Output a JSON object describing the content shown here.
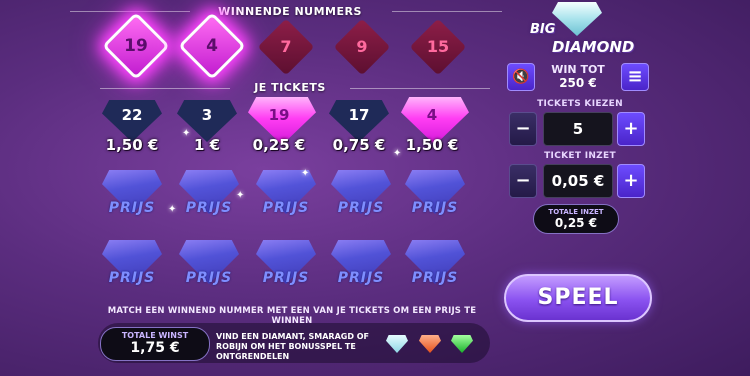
{
  "winning_section": {
    "title": "WINNENDE NUMMERS",
    "numbers": [
      {
        "value": "19",
        "matched": true
      },
      {
        "value": "4",
        "matched": true
      },
      {
        "value": "7",
        "matched": false
      },
      {
        "value": "9",
        "matched": false
      },
      {
        "value": "15",
        "matched": false
      }
    ]
  },
  "tickets_section": {
    "title": "JE TICKETS",
    "row1": [
      {
        "number": "22",
        "price": "1,50 €",
        "matched": false
      },
      {
        "number": "3",
        "price": "1 €",
        "matched": false
      },
      {
        "number": "19",
        "price": "0,25 €",
        "matched": true
      },
      {
        "number": "17",
        "price": "0,75 €",
        "matched": false
      },
      {
        "number": "4",
        "price": "1,50 €",
        "matched": true
      }
    ],
    "cover_label": "PRIJS"
  },
  "instruction": "MATCH EEN WINNEND NUMMER MET EEN VAN JE TICKETS OM EEN PRIJS TE WINNEN",
  "total_win": {
    "label": "TOTALE WINST",
    "value": "1,75 €"
  },
  "bonus_text": "VIND EEN DIAMANT, SMARAGD OF ROBIJN OM HET BONUSSPEL TE ONTGRENDELEN",
  "logo": {
    "line1": "BIG",
    "line2": "DIAMOND"
  },
  "win_tot": {
    "label": "WIN TOT",
    "value": "250 €"
  },
  "tickets_kiezen": {
    "label": "TICKETS KIEZEN",
    "value": "5",
    "minus": "−",
    "plus": "+"
  },
  "ticket_inzet": {
    "label": "TICKET INZET",
    "value": "0,05 €",
    "minus": "−",
    "plus": "+"
  },
  "totale_inzet": {
    "label": "TOTALE INZET",
    "value": "0,25 €"
  },
  "play_button": "SPEEL",
  "icons": {
    "sound": "speaker-muted-icon",
    "menu": "hamburger-menu-icon"
  },
  "colors": {
    "accent_pink": "#ff3df3",
    "button_purple": "#6d4cff",
    "background": "#5b2d7f"
  }
}
